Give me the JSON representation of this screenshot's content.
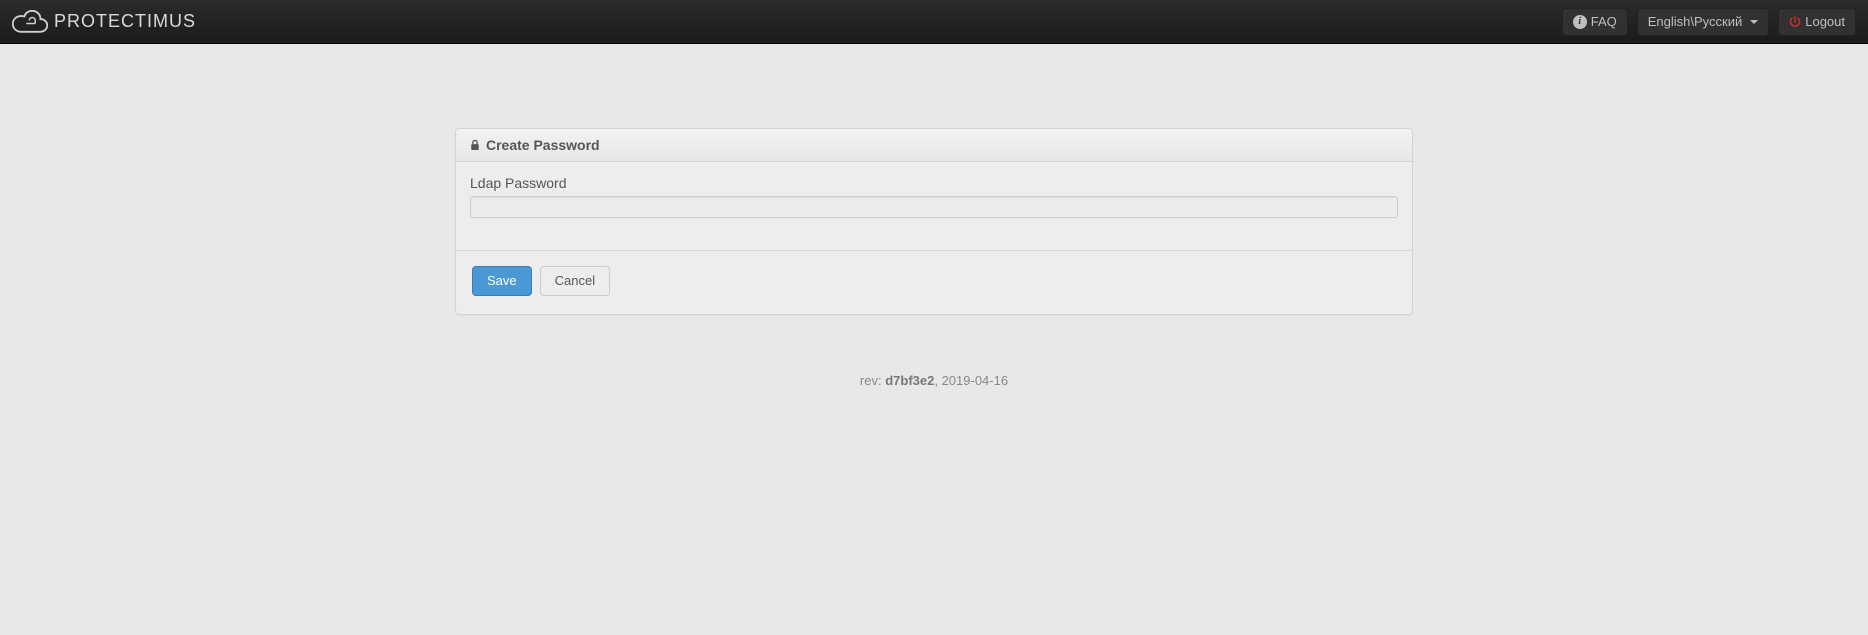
{
  "brand": {
    "name": "PROTECTIMUS"
  },
  "header": {
    "faq_label": "FAQ",
    "language_label": "English\\Русский",
    "logout_label": "Logout"
  },
  "panel": {
    "title": "Create Password",
    "field_label": "Ldap Password",
    "field_value": ""
  },
  "actions": {
    "save": "Save",
    "cancel": "Cancel"
  },
  "footer": {
    "rev_prefix": "rev: ",
    "rev_hash": "d7bf3e2",
    "rev_date": ", 2019-04-16"
  }
}
